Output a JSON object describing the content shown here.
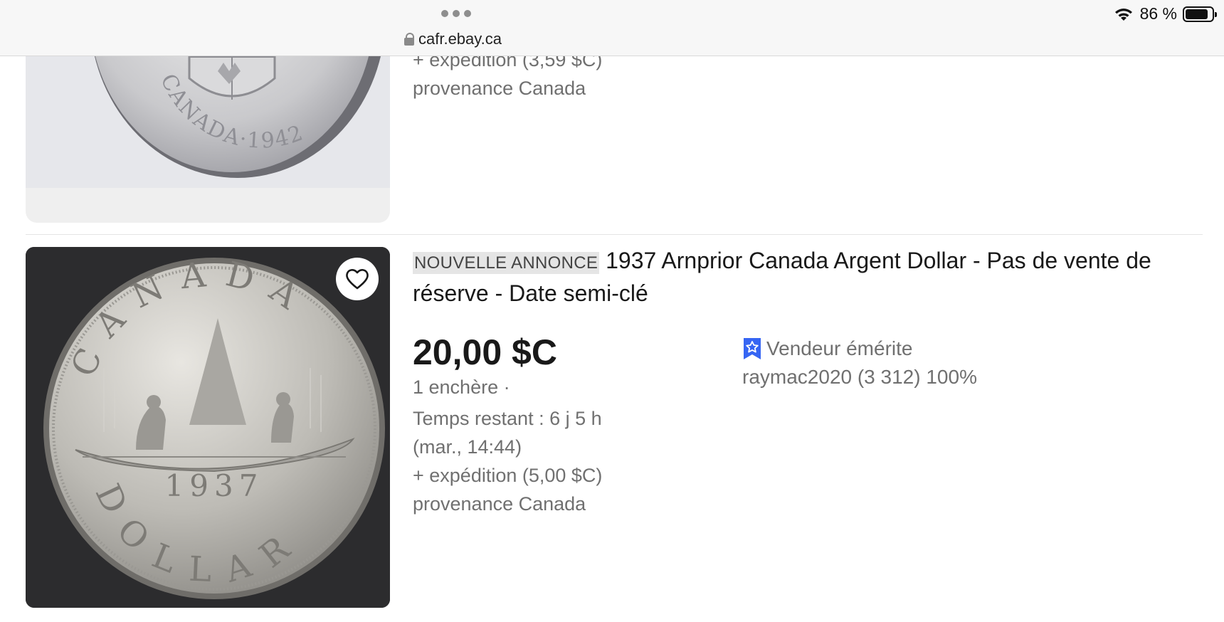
{
  "browser": {
    "url": "cafr.ebay.ca",
    "battery_percent": "86 %",
    "battery_level": 0.86
  },
  "listings": [
    {
      "shipping": "+ expédition (3,59 $C)",
      "origin": "provenance Canada",
      "coin_text": "CANADA·1942"
    },
    {
      "badge": "NOUVELLE ANNONCE",
      "title": "1937 Arnprior Canada Argent Dollar - Pas de vente de réserve - Date semi-clé",
      "price": "20,00 $C",
      "bids": "1 enchère ·",
      "time_left": "Temps restant : 6 j 5 h",
      "end_date": "(mar., 14:44)",
      "shipping": "+ expédition (5,00 $C)",
      "origin": "provenance Canada",
      "seller_badge": "Vendeur émérite",
      "seller_info": "raymac2020 (3 312) 100%",
      "coin_top": "CANADA",
      "coin_year": "1937",
      "coin_bottom": "DOLLAR"
    }
  ],
  "colors": {
    "text_primary": "#191919",
    "text_secondary": "#707070",
    "badge_bg": "#e5e5e5",
    "top_rated_blue": "#3665f3"
  },
  "icons": [
    "lock-icon",
    "wifi-icon",
    "battery-icon",
    "heart-icon",
    "top-rated-seller-icon",
    "tab-dots-icon"
  ]
}
